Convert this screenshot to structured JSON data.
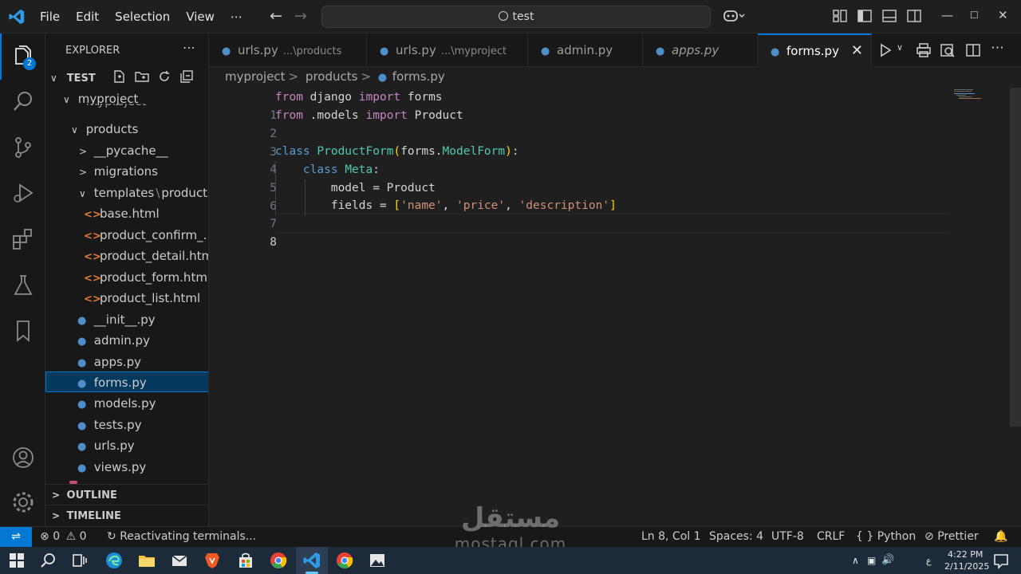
{
  "menu": [
    "File",
    "Edit",
    "Selection",
    "View",
    "⋯"
  ],
  "search": {
    "text": "test"
  },
  "explorer": {
    "title": "EXPLORER",
    "root": "TEST",
    "badge": "2",
    "items": [
      {
        "label": "myproject",
        "type": "folder-open"
      },
      {
        "label": "myproject",
        "type": "folder-closed"
      },
      {
        "label": "products",
        "type": "folder-open"
      },
      {
        "label": "__pycache__",
        "type": "folder-closed"
      },
      {
        "label": "migrations",
        "type": "folder-closed"
      },
      {
        "label": "templates",
        "label2": "products",
        "type": "folder-open"
      },
      {
        "label": "base.html",
        "type": "html"
      },
      {
        "label": "product_confirm_...",
        "type": "html"
      },
      {
        "label": "product_detail.html",
        "type": "html"
      },
      {
        "label": "product_form.html",
        "type": "html"
      },
      {
        "label": "product_list.html",
        "type": "html"
      },
      {
        "label": "__init__.py",
        "type": "py"
      },
      {
        "label": "admin.py",
        "type": "py"
      },
      {
        "label": "apps.py",
        "type": "py"
      },
      {
        "label": "forms.py",
        "type": "py",
        "selected": true
      },
      {
        "label": "models.py",
        "type": "py"
      },
      {
        "label": "tests.py",
        "type": "py"
      },
      {
        "label": "urls.py",
        "type": "py"
      },
      {
        "label": "views.py",
        "type": "py"
      }
    ],
    "outline": "OUTLINE",
    "timeline": "TIMELINE"
  },
  "tabs": [
    {
      "label": "urls.py",
      "desc": "...\\products"
    },
    {
      "label": "urls.py",
      "desc": "...\\myproject"
    },
    {
      "label": "admin.py",
      "desc": ""
    },
    {
      "label": "apps.py",
      "desc": ""
    },
    {
      "label": "forms.py",
      "desc": "",
      "active": true
    }
  ],
  "breadcrumb": [
    "myproject",
    "products",
    "forms.py"
  ],
  "code": {
    "current_line": 8,
    "lines": [
      "1",
      "2",
      "3",
      "4",
      "5",
      "6",
      "7",
      "8"
    ]
  },
  "status": {
    "errors": "0",
    "warnings": "0",
    "message": "Reactivating terminals...",
    "position": "Ln 8, Col 1",
    "spaces": "Spaces: 4",
    "encoding": "UTF-8",
    "eol": "CRLF",
    "language": "Python",
    "formatter": "Prettier"
  },
  "taskbar": {
    "time": "4:22 PM",
    "date": "2/11/2025",
    "lang": "ع"
  },
  "watermark": {
    "arabic": "مستقل",
    "latin": "mostaql.com"
  },
  "colors": {
    "accent": "#0078d4",
    "selection": "#04395e"
  }
}
